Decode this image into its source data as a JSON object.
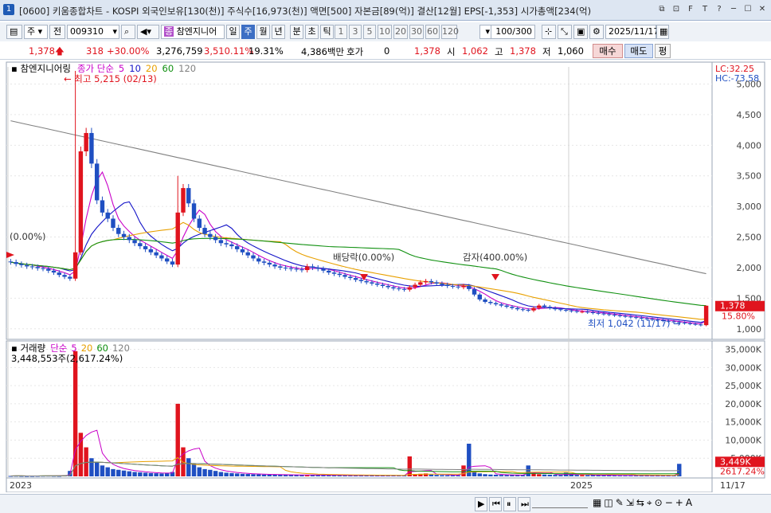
{
  "titlebar": {
    "num": "1",
    "title": "[0600] 키움종합차트 - KOSPI 외국인보유[130(천)] 주식수[16,973(천)] 액면[500] 자본금[89(억)] 결산[12월] EPS[-1,353] 시가총액[234(억)",
    "buttons": [
      "⧉",
      "⊡",
      "F",
      "T",
      "?",
      "─",
      "☐",
      "✕"
    ]
  },
  "toolbar": {
    "type": "주",
    "market": "전",
    "code": "009310",
    "name": "참엔지니어",
    "periods": [
      "일",
      "주",
      "월",
      "년",
      "분",
      "초",
      "틱"
    ],
    "selected_period": "주",
    "numbers": [
      "1",
      "3",
      "5",
      "10",
      "20",
      "30",
      "60",
      "120"
    ],
    "count": "100/300",
    "date": "2025/11/17"
  },
  "infobar": {
    "price": "1,378",
    "change": "318",
    "change_pct": "+30.00%",
    "volume": "3,276,759",
    "volume_pct": "3,510.11%",
    "turnover": "19.31%",
    "amount": "4,386백만",
    "hoga_label": "호가",
    "hoga": "0",
    "hoga_price": "1,378",
    "open_label": "시",
    "open": "1,062",
    "high_label": "고",
    "high": "1,378",
    "low_label": "저",
    "low": "1,060",
    "buy": "매수",
    "sell": "매도",
    "avg": "평"
  },
  "chart_data": [
    {
      "type": "candlestick",
      "legend": {
        "label": "참엔지니어링",
        "ma_label": "종가 단순",
        "ma_periods": [
          "5",
          "10",
          "20",
          "60",
          "120"
        ]
      },
      "ma_colors": [
        "#c800c8",
        "#1414c8",
        "#e8a000",
        "#109010",
        "#808080"
      ],
      "y_ticks": [
        1000,
        1500,
        2000,
        2500,
        3000,
        3500,
        4000,
        4500,
        5000
      ],
      "ylim": [
        880,
        5280
      ],
      "x_labels": [
        {
          "index": 0,
          "label": "2023"
        },
        {
          "index": 104,
          "label": "2025"
        }
      ],
      "annotations": {
        "high": "최고 5,215 (02/13)",
        "low": "최저 1,042 (11/17)",
        "left_marker": "(0.00%)",
        "dividend": "배당락(0.00%)",
        "reduction": "감자(400.00%)"
      },
      "right_labels": {
        "lc": "LC:32.25",
        "hc": "HC:-73.58",
        "price": "1,378",
        "pct": "15.80%"
      },
      "values": {
        "start": 2100,
        "w1": [
          2090,
          2060,
          2040,
          2020,
          2010,
          1990,
          1980,
          1950,
          1920,
          1880,
          1850,
          1820,
          2250,
          3900,
          4200,
          3700,
          3100,
          2900,
          2800,
          2650,
          2550,
          2500,
          2450,
          2400,
          2350,
          2300,
          2250,
          2200,
          2150,
          2100,
          2050,
          2900,
          3300,
          3050,
          2800,
          2650,
          2550,
          2500,
          2450,
          2400,
          2380,
          2350,
          2300,
          2250,
          2200,
          2150,
          2100,
          2080,
          2050,
          2020,
          2000,
          1990,
          1980,
          1970,
          1960,
          2020,
          2000,
          1980,
          1950,
          1920,
          1900,
          1880,
          1850,
          1830,
          1800,
          1780,
          1760,
          1740,
          1720,
          1700,
          1680,
          1660,
          1650,
          1640,
          1680,
          1720,
          1760,
          1780,
          1760,
          1740,
          1720,
          1700,
          1690,
          1680,
          1700,
          1650,
          1560,
          1480,
          1440,
          1420,
          1400,
          1380,
          1360,
          1340,
          1320,
          1310,
          1300,
          1340,
          1380,
          1360,
          1340,
          1320,
          1310,
          1300,
          1290,
          1280,
          1280,
          1270,
          1260,
          1250,
          1240,
          1230,
          1220,
          1210,
          1200,
          1190,
          1180,
          1170,
          1160,
          1150,
          1140,
          1130,
          1120,
          1110,
          1100,
          1090,
          1080,
          1070,
          1060,
          1378
        ]
      }
    },
    {
      "type": "bar",
      "legend": {
        "label": "거래량",
        "ma_label": "단순",
        "ma_periods": [
          "5",
          "20",
          "60",
          "120"
        ]
      },
      "ma_colors": [
        "#c800c8",
        "#e8a000",
        "#109010",
        "#808080"
      ],
      "y_ticks": [
        "5,000K",
        "10,000K",
        "15,000K",
        "20,000K",
        "25,000K",
        "30,000K",
        "35,000K"
      ],
      "ylim": [
        0,
        36000
      ],
      "annotation": "3,448,553주(2,617.24%)",
      "right_labels": {
        "vol": "3,449K",
        "pct": "2617.24%"
      },
      "x_label_right": "11/17",
      "values": [
        120,
        150,
        110,
        90,
        100,
        130,
        160,
        180,
        140,
        120,
        300,
        1500,
        34500,
        12000,
        8000,
        5000,
        4000,
        3000,
        2500,
        2000,
        1800,
        1600,
        1400,
        1200,
        1100,
        1000,
        900,
        850,
        800,
        900,
        1200,
        20000,
        8000,
        5000,
        3500,
        2500,
        2000,
        1800,
        1500,
        1200,
        1000,
        900,
        800,
        700,
        650,
        600,
        550,
        500,
        480,
        460,
        440,
        420,
        400,
        380,
        360,
        400,
        380,
        360,
        340,
        320,
        300,
        300,
        280,
        280,
        260,
        260,
        250,
        250,
        240,
        240,
        230,
        230,
        220,
        220,
        5500,
        600,
        700,
        800,
        500,
        400,
        350,
        300,
        300,
        280,
        3000,
        9000,
        1200,
        800,
        600,
        500,
        450,
        400,
        380,
        360,
        340,
        330,
        3000,
        900,
        600,
        500,
        450,
        400,
        380,
        1000,
        500,
        400,
        380,
        360,
        340,
        320,
        300,
        300,
        280,
        280,
        260,
        260,
        250,
        250,
        240,
        240,
        230,
        230,
        220,
        220,
        3449
      ]
    }
  ]
}
